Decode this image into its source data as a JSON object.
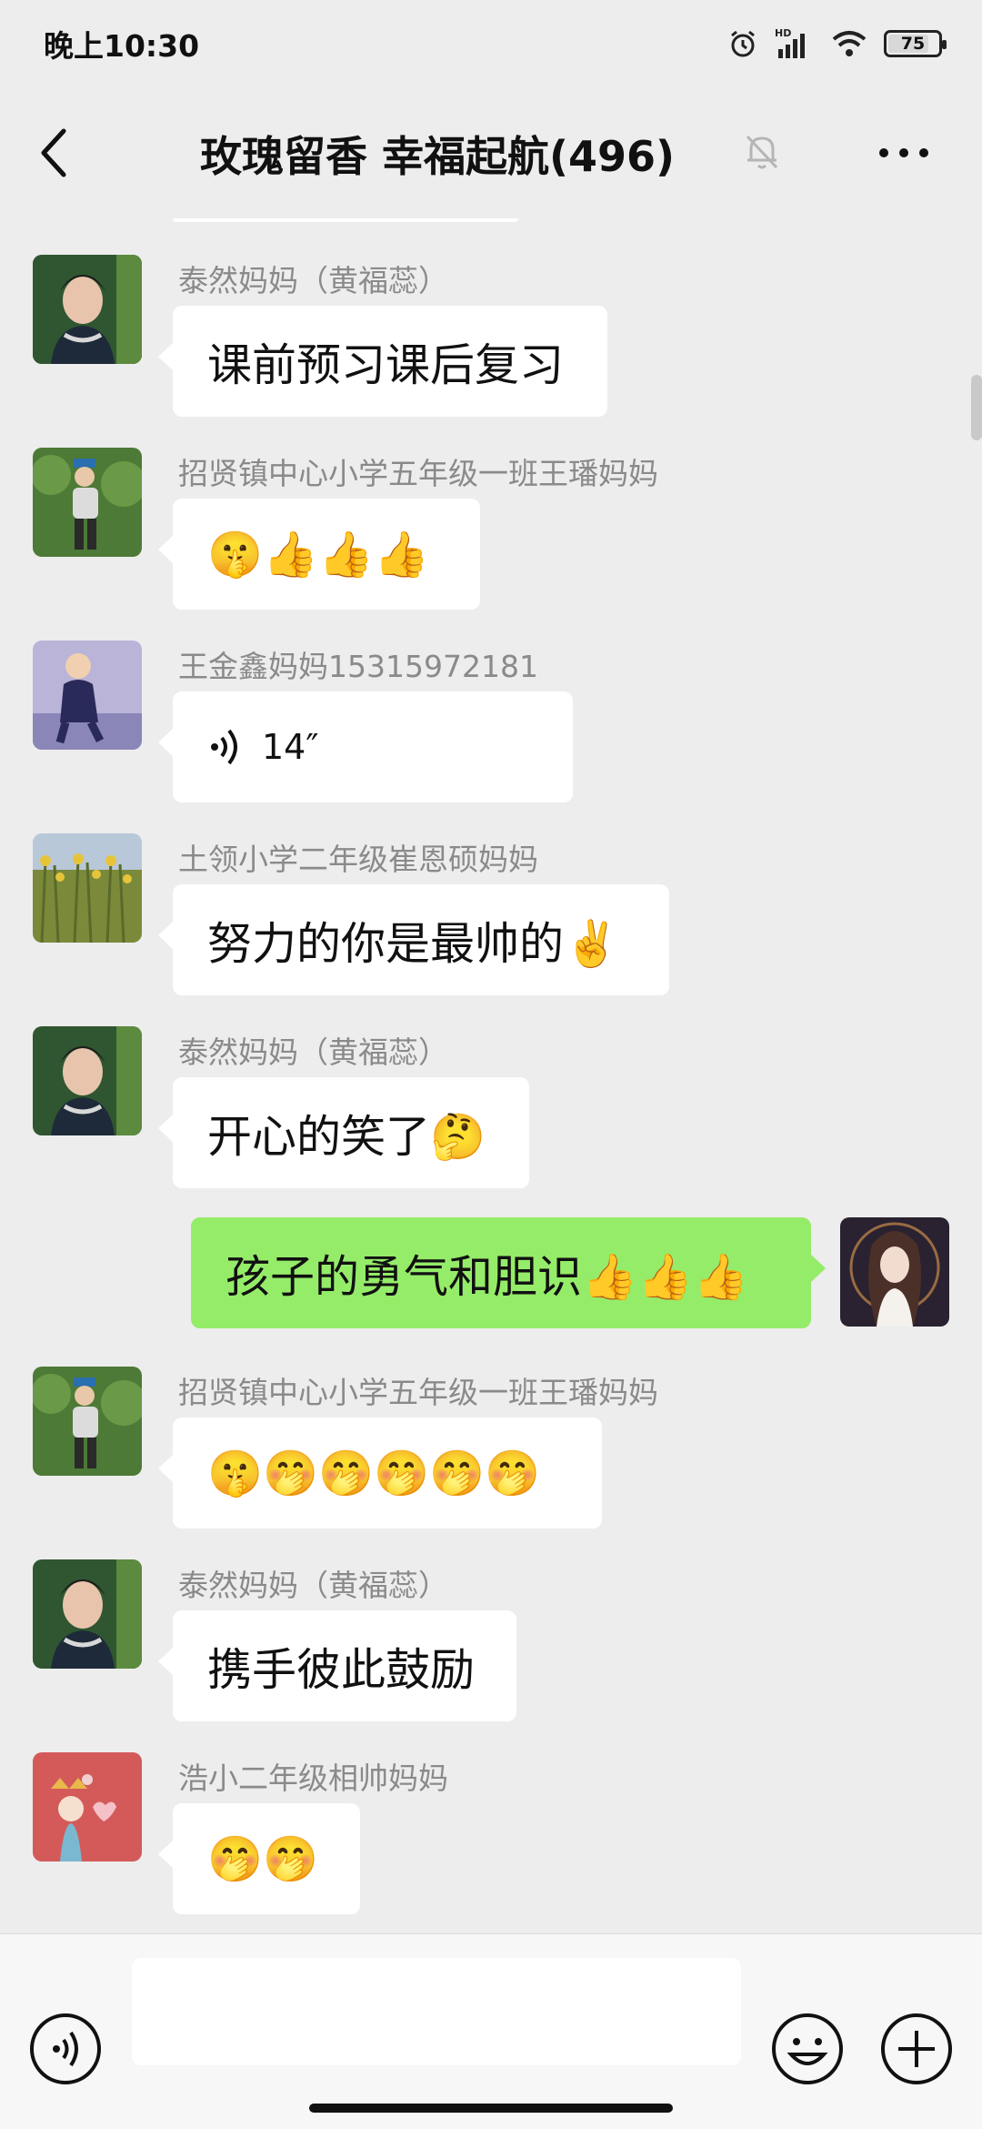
{
  "status": {
    "time": "晚上10:30",
    "battery": "75",
    "battery_level": 0.75
  },
  "header": {
    "title": "玫瑰留香  幸福起航(496)"
  },
  "messages": [
    {
      "sender": "泰然妈妈（黄福蕊）",
      "text": "课前预习课后复习"
    },
    {
      "sender": "招贤镇中心小学五年级一班王璠妈妈",
      "text": "🤫👍👍👍"
    },
    {
      "sender": "王金鑫妈妈15315972181",
      "voice_length": "14″"
    },
    {
      "sender": "土领小学二年级崔恩硕妈妈",
      "text": "努力的你是最帅的✌️"
    },
    {
      "sender": "泰然妈妈（黄福蕊）",
      "text": "开心的笑了🤔"
    },
    {
      "text": "孩子的勇气和胆识👍👍👍"
    },
    {
      "sender": "招贤镇中心小学五年级一班王璠妈妈",
      "text": "🤫🤭🤭🤭🤭🤭"
    },
    {
      "sender": "泰然妈妈（黄福蕊）",
      "text": "携手彼此鼓励"
    },
    {
      "sender": "浩小二年级相帅妈妈",
      "text": "🤭🤭"
    }
  ],
  "colors": {
    "background": "#ededed",
    "incoming_bubble": "#ffffff",
    "outgoing_bubble": "#95ec69"
  },
  "icons": [
    "back-icon",
    "mute-icon",
    "more-icon",
    "voice-icon",
    "emoji-icon",
    "plus-icon"
  ]
}
